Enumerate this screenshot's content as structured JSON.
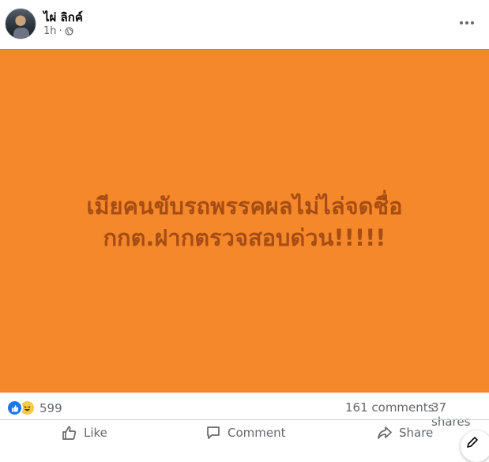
{
  "post": {
    "author": "ไผ่ ลิกค์",
    "time": "1h",
    "separator": "·",
    "privacy_icon": "globe-icon",
    "more_icon": "more-dots-icon"
  },
  "image": {
    "background": "#f5882a",
    "text_color": "#a64d14",
    "line1": "เมียคนขับรถพรรคผลไม่ไล่จดชื่อ",
    "line2": "กกต.ฝากตรวจสอบด่วน!!!!!"
  },
  "stats": {
    "reactions_count": "599",
    "reaction_icons": [
      "like-icon",
      "haha-icon"
    ],
    "comments": "161 comments",
    "shares": "37 shares"
  },
  "actions": {
    "like": "Like",
    "comment": "Comment",
    "share": "Share"
  },
  "colors": {
    "accent": "#1877f2",
    "muted_text": "#65676b"
  }
}
